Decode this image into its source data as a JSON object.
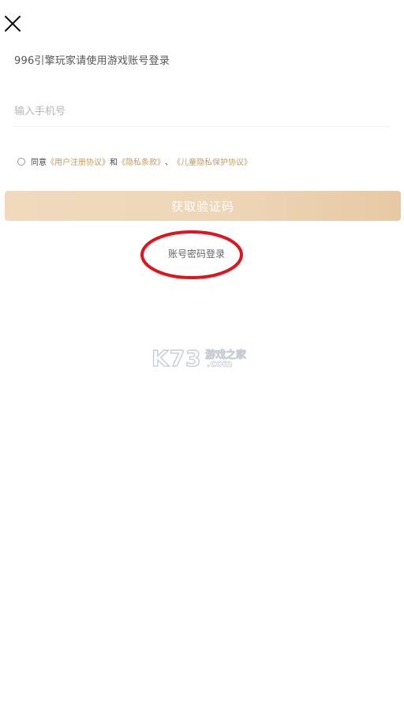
{
  "header": {
    "close_icon": "close-icon"
  },
  "login": {
    "subtitle": "996引擎玩家请使用游戏账号登录",
    "phone_placeholder": "输入手机号",
    "phone_value": ""
  },
  "agreement": {
    "checked": false,
    "agree_text": "同意",
    "user_agreement": "《用户注册协议》",
    "and_text": "和",
    "privacy_terms": "《隐私条款》",
    "separator": "、",
    "child_privacy": "《儿童隐私保护协议》"
  },
  "actions": {
    "get_code_label": "获取验证码",
    "account_login_label": "账号密码登录"
  },
  "watermark": {
    "brand": "K73",
    "tagline": "游戏之家",
    "domain": ".com"
  },
  "colors": {
    "accent_gold": "#c79a5c",
    "button_gradient_start": "#f1d9bd",
    "button_gradient_end": "#e7c9a4",
    "annotation_red": "#e0141e"
  }
}
